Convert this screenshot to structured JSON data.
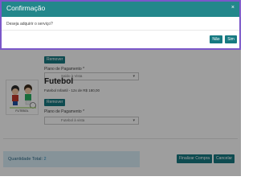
{
  "background": {
    "top_button_label": "Remover",
    "plan1": {
      "label": "Plano de Pagamento *",
      "selected": "Saldo à Vista"
    },
    "product": {
      "thumb_caption": "FUTEBOL",
      "title": "Futebol",
      "description": "Futebol Infantil - 12x de R$ 180,00",
      "remove_label": "Remover",
      "plan_label": "Plano de Pagamento *",
      "plan_selected": "Futebol à vista"
    },
    "quantity": {
      "label": "Quantidade Total:",
      "value": "2"
    },
    "finalize_label": "Finalizar Compra",
    "cancel_label": "Cancelar"
  },
  "modal": {
    "title": "Confirmação",
    "close_symbol": "×",
    "message": "Deseja adquirir o serviço?",
    "no_label": "Não",
    "yes_label": "Sim"
  },
  "colors": {
    "accent": "#177a82",
    "modal_header": "#23878b",
    "modal_border": "#7b57c9",
    "qty_panel": "#d9edf7"
  },
  "icons": {
    "dropdown": "chevron-down-icon",
    "close": "close-icon"
  }
}
